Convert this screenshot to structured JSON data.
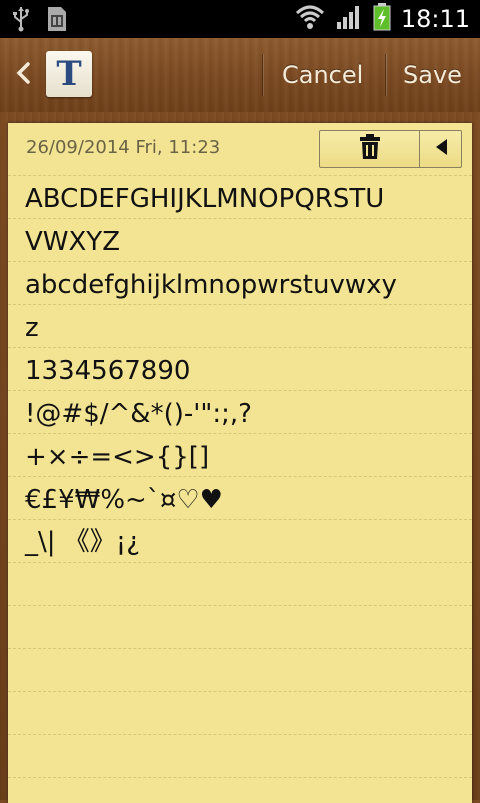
{
  "status_bar": {
    "time": "18:11",
    "icons": [
      "usb-icon",
      "sim-card-icon",
      "wifi-icon",
      "signal-icon",
      "battery-charging-icon"
    ]
  },
  "action_bar": {
    "app_icon_letter": "T",
    "cancel_label": "Cancel",
    "save_label": "Save"
  },
  "note": {
    "date": "26/09/2014 Fri, 11:23",
    "lines": [
      "ABCDEFGHIJKLMNOPQRSTU",
      "VWXYZ",
      "abcdefghijklmnopwrstuvwxy",
      "z",
      "1334567890",
      "!@#$/^&*()-'\":;,?",
      "+×÷=<>{}[]",
      "€£¥₩%~`¤♡♥",
      "_\\| 《》¡¿",
      "",
      "",
      "",
      "",
      "",
      ""
    ]
  }
}
